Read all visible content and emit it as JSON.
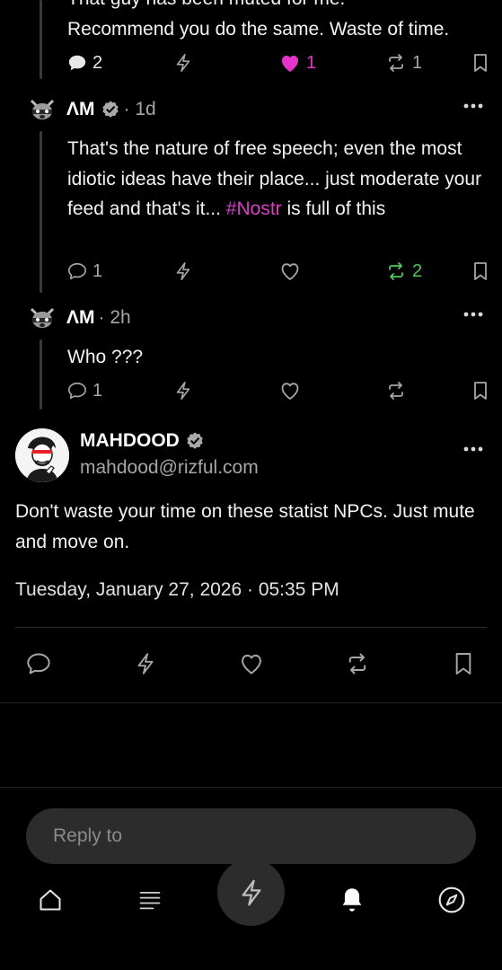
{
  "post1": {
    "partial_line": "That guy has been muted for me.",
    "last_line": "Recommend you do the same. Waste of time.",
    "replies": "2",
    "likes": "1",
    "reposts": "1"
  },
  "post2": {
    "author": "ΛM",
    "time": "1d",
    "text_before": "That's the nature of free speech; even the most idiotic ideas have their place... just moderate your feed and that's it... ",
    "hashtag": "#Nostr",
    "text_after": " is full of this",
    "replies": "1",
    "reposts": "2"
  },
  "post3": {
    "author": "ΛM",
    "time": "2h",
    "text": "Who ???",
    "replies": "1"
  },
  "main_post": {
    "author": "MAHDOOD",
    "handle": "mahdood@rizful.com",
    "text": "Don't waste your time on these statist NPCs. Just mute and move on.",
    "datetime": "Tuesday, January 27, 2026 · 05:35 PM"
  },
  "reply": {
    "placeholder": "Reply to"
  },
  "colors": {
    "accent_pink": "#e535c8",
    "repost_green": "#4fc85a",
    "hashtag": "#d63fc4"
  },
  "icons": [
    "reply-icon",
    "zap-icon",
    "heart-icon",
    "repost-icon",
    "bookmark-icon",
    "more-icon",
    "home-icon",
    "feed-icon",
    "bell-icon",
    "compass-icon",
    "verified-icon"
  ]
}
